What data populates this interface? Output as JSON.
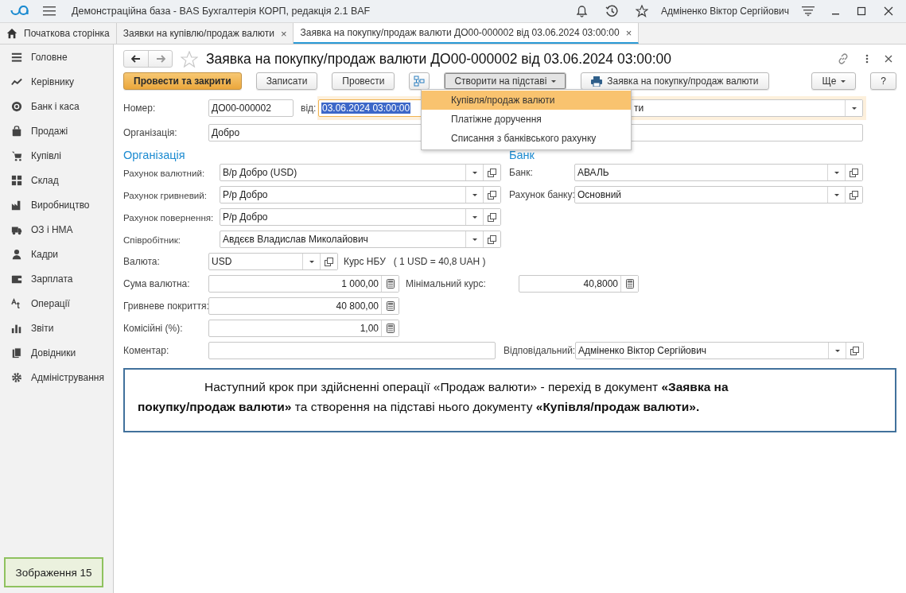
{
  "app": {
    "title": "Демонстраційна база - BAS Бухгалтерія КОРП, редакція 2.1 BAF",
    "user": "Адміненко Віктор Сергійович"
  },
  "tabs": [
    {
      "label": "Початкова сторінка",
      "kind": "home",
      "selected": false
    },
    {
      "label": "Заявки на купівлю/продаж валюти",
      "kind": "closable",
      "close": "×",
      "selected": false
    },
    {
      "label": "Заявка на покупку/продаж валюти ДО00-000002 від 03.06.2024 03:00:00",
      "kind": "closable",
      "close": "×",
      "selected": true
    }
  ],
  "sidebar": [
    {
      "label": "Головне"
    },
    {
      "label": "Керівнику"
    },
    {
      "label": "Банк і каса"
    },
    {
      "label": "Продажі"
    },
    {
      "label": "Купівлі"
    },
    {
      "label": "Склад"
    },
    {
      "label": "Виробництво"
    },
    {
      "label": "ОЗ і НМА"
    },
    {
      "label": "Кадри"
    },
    {
      "label": "Зарплата"
    },
    {
      "label": "Операції"
    },
    {
      "label": "Звіти"
    },
    {
      "label": "Довідники"
    },
    {
      "label": "Адміністрування"
    }
  ],
  "caption": "Зображення 15",
  "document": {
    "title": "Заявка на покупку/продаж валюти ДО00-000002 від 03.06.2024 03:00:00"
  },
  "toolbar": [
    {
      "label": "Провести та закрити",
      "kind": "primary"
    },
    {
      "label": "Записати",
      "kind": "plain"
    },
    {
      "label": "Провести",
      "kind": "plain"
    },
    {
      "kind": "structure"
    },
    {
      "label": "Створити на підставі",
      "kind": "menu",
      "expanded": true
    },
    {
      "label": "Заявка на покупку/продаж валюти",
      "kind": "print"
    }
  ],
  "toolbar_right": [
    {
      "label": "Ще",
      "kind": "menu",
      "expanded": false
    },
    {
      "label": "?",
      "kind": "plain"
    }
  ],
  "menu": [
    {
      "label": "Купівля/продаж валюти",
      "selected": true
    },
    {
      "label": "Платіжне доручення",
      "selected": false
    },
    {
      "label": "Списання з банківського рахунку",
      "selected": false
    }
  ],
  "form": {
    "number": {
      "label": "Номер:",
      "value": "ДО00-000002"
    },
    "date": {
      "label": "від:",
      "value": "03.06.2024 03:00:00",
      "selected": true
    },
    "operation": {
      "value": "ти"
    },
    "organization": {
      "label": "Організація:",
      "value": "Добро"
    },
    "sections": [
      "Організація",
      "Банк"
    ],
    "left_rows": [
      {
        "label": "Рахунок валютний:",
        "value": "В/р Добро (USD)"
      },
      {
        "label": "Рахунок гривневий:",
        "value": "Р/р Добро"
      },
      {
        "label": "Рахунок повернення:",
        "value": "Р/р Добро"
      },
      {
        "label": "Співробітник:",
        "value": "Авдєєв Владислав Миколайович"
      }
    ],
    "right_rows": [
      {
        "label": "Банк:",
        "value": "АВАЛЬ"
      },
      {
        "label": "Рахунок банку:",
        "value": "Основний"
      }
    ],
    "currency": {
      "label": "Валюта:",
      "value": "USD",
      "rate_label": "Курс НБУ",
      "rate": "( 1 USD = 40,8 UAH )"
    },
    "amount": {
      "label": "Сума валютна:",
      "value": "1 000,00"
    },
    "min_rate": {
      "label": "Мінімальний курс:",
      "value": "40,8000"
    },
    "coverage": {
      "label": "Гривневе покриття:",
      "value": "40 800,00"
    },
    "commission": {
      "label": "Комісійні (%):",
      "value": "1,00"
    },
    "comment": {
      "label": "Коментар:"
    },
    "responsible": {
      "label": "Відповідальний:",
      "value": "Адміненко Віктор Сергійович"
    }
  },
  "note": "Наступний крок при здійсненні операції «Продаж валюти» - перехід в документ **«Заявка на покупку/продаж валюти»** та створення на підставі нього документу **«Купівля/продаж валюти».**"
}
